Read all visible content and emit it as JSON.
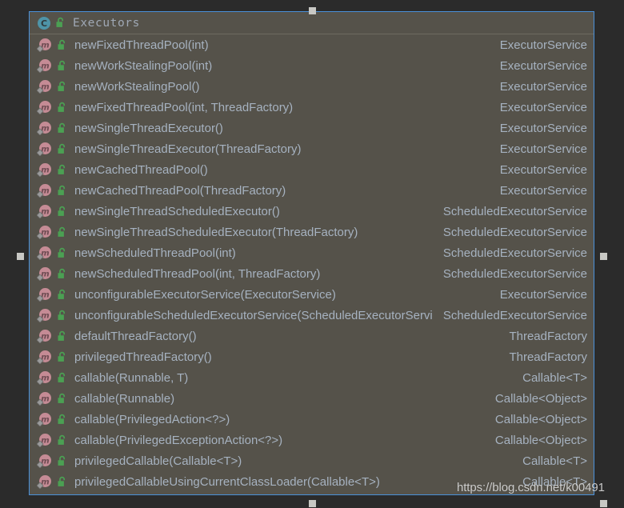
{
  "window": {
    "background_color": "#2b2b2b",
    "popup_background_color": "#55524a",
    "popup_border_color": "#4a90d9",
    "text_color": "#a6b2c0",
    "class_icon_color": "#4e94a8",
    "method_icon_color": "#c58b95",
    "lock_icon_color": "#4ba053"
  },
  "header": {
    "title": "Executors",
    "class_icon": "class-c-icon",
    "visibility_icon": "public-unlock-icon"
  },
  "members": [
    {
      "icon": "method-icon",
      "visibility": "public-unlock-icon",
      "name": "newFixedThreadPool(int)",
      "type": "ExecutorService"
    },
    {
      "icon": "method-icon",
      "visibility": "public-unlock-icon",
      "name": "newWorkStealingPool(int)",
      "type": "ExecutorService"
    },
    {
      "icon": "method-icon",
      "visibility": "public-unlock-icon",
      "name": "newWorkStealingPool()",
      "type": "ExecutorService"
    },
    {
      "icon": "method-icon",
      "visibility": "public-unlock-icon",
      "name": "newFixedThreadPool(int, ThreadFactory)",
      "type": "ExecutorService"
    },
    {
      "icon": "method-icon",
      "visibility": "public-unlock-icon",
      "name": "newSingleThreadExecutor()",
      "type": "ExecutorService"
    },
    {
      "icon": "method-icon",
      "visibility": "public-unlock-icon",
      "name": "newSingleThreadExecutor(ThreadFactory)",
      "type": "ExecutorService"
    },
    {
      "icon": "method-icon",
      "visibility": "public-unlock-icon",
      "name": "newCachedThreadPool()",
      "type": "ExecutorService"
    },
    {
      "icon": "method-icon",
      "visibility": "public-unlock-icon",
      "name": "newCachedThreadPool(ThreadFactory)",
      "type": "ExecutorService"
    },
    {
      "icon": "method-icon",
      "visibility": "public-unlock-icon",
      "name": "newSingleThreadScheduledExecutor()",
      "type": "ScheduledExecutorService"
    },
    {
      "icon": "method-icon",
      "visibility": "public-unlock-icon",
      "name": "newSingleThreadScheduledExecutor(ThreadFactory)",
      "type": "ScheduledExecutorService"
    },
    {
      "icon": "method-icon",
      "visibility": "public-unlock-icon",
      "name": "newScheduledThreadPool(int)",
      "type": "ScheduledExecutorService"
    },
    {
      "icon": "method-icon",
      "visibility": "public-unlock-icon",
      "name": "newScheduledThreadPool(int, ThreadFactory)",
      "type": "ScheduledExecutorService"
    },
    {
      "icon": "method-icon",
      "visibility": "public-unlock-icon",
      "name": "unconfigurableExecutorService(ExecutorService)",
      "type": "ExecutorService"
    },
    {
      "icon": "method-icon",
      "visibility": "public-unlock-icon",
      "name": "unconfigurableScheduledExecutorService(ScheduledExecutorService)",
      "type": "ScheduledExecutorService"
    },
    {
      "icon": "method-icon",
      "visibility": "public-unlock-icon",
      "name": "defaultThreadFactory()",
      "type": "ThreadFactory"
    },
    {
      "icon": "method-icon",
      "visibility": "public-unlock-icon",
      "name": "privilegedThreadFactory()",
      "type": "ThreadFactory"
    },
    {
      "icon": "method-icon",
      "visibility": "public-unlock-icon",
      "name": "callable(Runnable, T)",
      "type": "Callable<T>"
    },
    {
      "icon": "method-icon",
      "visibility": "public-unlock-icon",
      "name": "callable(Runnable)",
      "type": "Callable<Object>"
    },
    {
      "icon": "method-icon",
      "visibility": "public-unlock-icon",
      "name": "callable(PrivilegedAction<?>)",
      "type": "Callable<Object>"
    },
    {
      "icon": "method-icon",
      "visibility": "public-unlock-icon",
      "name": "callable(PrivilegedExceptionAction<?>)",
      "type": "Callable<Object>"
    },
    {
      "icon": "method-icon",
      "visibility": "public-unlock-icon",
      "name": "privilegedCallable(Callable<T>)",
      "type": "Callable<T>"
    },
    {
      "icon": "method-icon",
      "visibility": "public-unlock-icon",
      "name": "privilegedCallableUsingCurrentClassLoader(Callable<T>)",
      "type": "Callable<T>"
    }
  ],
  "resize_handles": [
    {
      "name": "resize-handle-top"
    },
    {
      "name": "resize-handle-left"
    },
    {
      "name": "resize-handle-right"
    },
    {
      "name": "resize-handle-bottom"
    },
    {
      "name": "resize-handle-bottom-right"
    }
  ],
  "watermark": {
    "text": "https://blog.csdn.net/k00491"
  }
}
